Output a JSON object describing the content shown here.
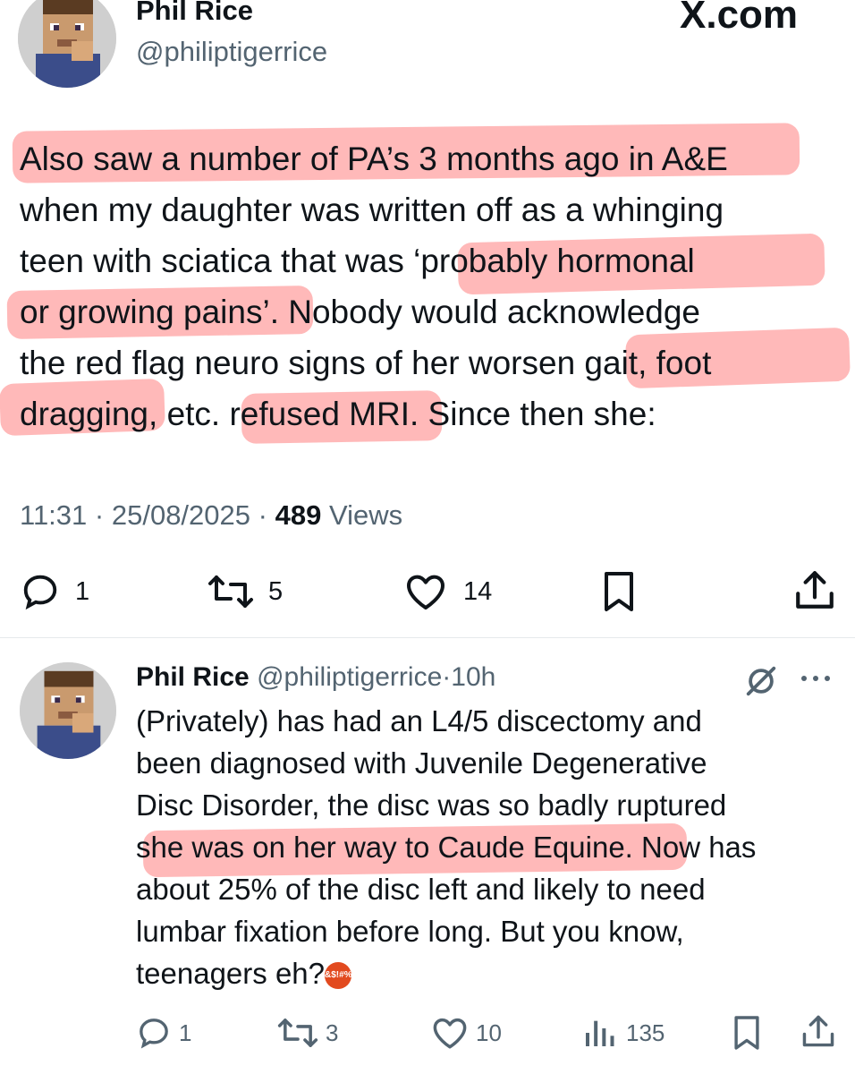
{
  "main_tweet": {
    "author_name": "Phil Rice",
    "handle": "@philiptigerrice",
    "site_watermark": "X.com",
    "lines": [
      "Also saw a number of PA’s 3 months ago in A&E",
      "when my daughter was written off as a whinging",
      "teen with sciatica that was ‘probably hormonal",
      "or growing pains’.  Nobody would acknowledge",
      "the red flag neuro signs of her worsen gait, foot",
      "dragging, etc. refused MRI. Since then she:"
    ],
    "meta": {
      "time": "11:31",
      "sep1": "·",
      "date": "25/08/2025",
      "sep2": "·",
      "views_count": "489",
      "views_label": "Views"
    },
    "actions": {
      "reply_icon": "reply-icon",
      "reply_count": "1",
      "retweet_icon": "retweet-icon",
      "retweet_count": "5",
      "like_icon": "heart-icon",
      "like_count": "14",
      "bookmark_icon": "bookmark-icon",
      "share_icon": "share-icon"
    }
  },
  "reply_tweet": {
    "author_name": "Phil Rice",
    "handle": "@philiptigerrice",
    "sep": "·",
    "time_ago": "10h",
    "grok_icon": "slash-circle-icon",
    "more_icon": "more-icon",
    "lines": [
      "(Privately) has had an L4/5 discectomy and",
      "been diagnosed with Juvenile Degenerative",
      "Disc Disorder, the disc was so badly ruptured",
      "she was on her way to Caude Equine. Now has",
      "about 25% of the disc left and likely to need",
      "lumbar fixation before long.  But you know,",
      "teenagers eh?"
    ],
    "emoji_text": "&$!#%",
    "actions": {
      "reply_count": "1",
      "retweet_count": "3",
      "like_count": "10",
      "views_count": "135"
    }
  },
  "colors": {
    "highlight": "#ff7878",
    "text": "#0f1419",
    "muted": "#536471"
  }
}
